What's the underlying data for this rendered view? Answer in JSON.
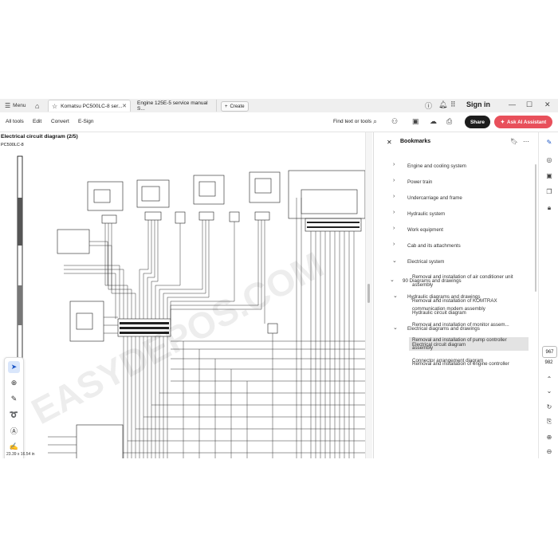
{
  "tabbar": {
    "menu_label": "Menu",
    "tabs": [
      {
        "label": "Komatsu PC500LC-8 ser..."
      },
      {
        "label": "Engine 125E-5 service manual S..."
      }
    ],
    "create_label": "Create",
    "signin_label": "Sign in"
  },
  "toolbar": {
    "menu": [
      "All tools",
      "Edit",
      "Convert",
      "E-Sign"
    ],
    "find_label": "Find text or tools",
    "share_label": "Share",
    "ai_label": "Ask AI Assistant"
  },
  "document": {
    "title": "Electrical circuit diagram (2/5)",
    "subtitle": "PC500LC-8",
    "dimensions": "23.39 x 16.54 in",
    "watermark": "EASYDEPOS.COM"
  },
  "bookmarks": {
    "title": "Bookmarks",
    "items": [
      {
        "label": "Engine and cooling system"
      },
      {
        "label": "Power train"
      },
      {
        "label": "Undercarriage and frame"
      },
      {
        "label": "Hydraulic system"
      },
      {
        "label": "Work equipment"
      },
      {
        "label": "Cab and its attachments"
      },
      {
        "label": "Electrical system"
      },
      {
        "label": "Removal and installation of air conditioner unit assembly"
      },
      {
        "label": "Removal and installation of KOMTRAX communication modem assembly"
      },
      {
        "label": "Removal and installation of monitor assem..."
      },
      {
        "label": "Removal and installation of pump controller assembly"
      },
      {
        "label": "Removal and installation of engine controller"
      },
      {
        "label": "90 Diagrams and drawings"
      },
      {
        "label": "Hydraulic diagrams and drawings"
      },
      {
        "label": "Hydraulic circuit diagram"
      },
      {
        "label": "Electrical diagrams and drawings"
      },
      {
        "label": "Electrical circuit diagram"
      },
      {
        "label": "Connector arrangement diagram"
      }
    ]
  },
  "rail": {
    "page_current": "967",
    "page_total": "982"
  },
  "colors": {
    "ai_button": "#e8505b",
    "share_button": "#1c1c1c",
    "selected_bookmark": "#e3e3e3",
    "selected_tool": "#d9e6fb"
  }
}
